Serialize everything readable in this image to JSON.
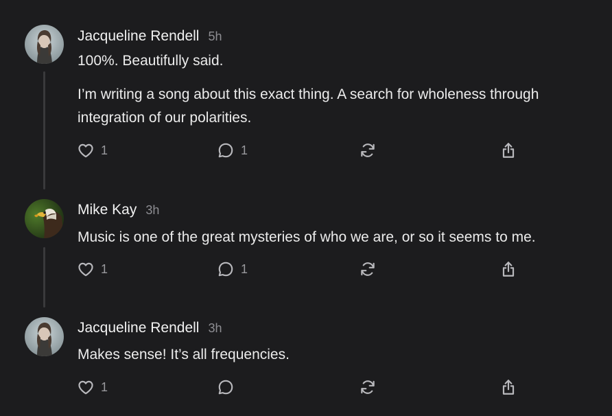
{
  "comments": [
    {
      "author": "Jacqueline Rendell",
      "time": "5h",
      "avatar": "woman-portrait-avatar",
      "paragraphs": [
        "100%. Beautifully said.",
        "I’m writing a song about this exact thing. A search for wholeness through integration of our polarities."
      ],
      "likes": "1",
      "replies": "1"
    },
    {
      "author": "Mike Kay",
      "time": "3h",
      "avatar": "eagle-avatar",
      "paragraphs": [
        "Music is one of the great mysteries of who we are, or so it seems to me."
      ],
      "likes": "1",
      "replies": "1"
    },
    {
      "author": "Jacqueline Rendell",
      "time": "3h",
      "avatar": "woman-portrait-avatar",
      "paragraphs": [
        "Makes sense! It’s all frequencies."
      ],
      "likes": "1",
      "replies": ""
    }
  ],
  "icons": {
    "like": "heart-icon",
    "reply": "comment-bubble-icon",
    "restack": "restack-icon",
    "share": "share-icon"
  },
  "colors": {
    "background": "#1c1c1e",
    "text": "#ececec",
    "muted": "#8e8e93",
    "thread_line": "#3a3a3c"
  }
}
